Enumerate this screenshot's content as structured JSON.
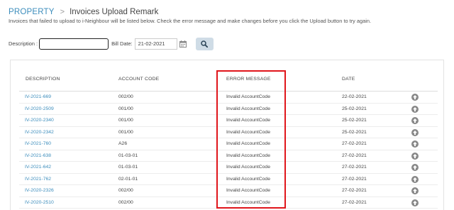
{
  "breadcrumb": {
    "root": "PROPERTY",
    "separator": ">",
    "current": "Invoices Upload Remark"
  },
  "subtitle": "Invoices that failed to upload to i-Neighbour will be listed below. Check the error message and make changes before you click the Upload button to try again.",
  "filters": {
    "description_label": "Description :",
    "description_value": "",
    "bill_date_label": "Bill Date:",
    "bill_date_value": "21-02-2021",
    "calendar_icon": "calendar-icon",
    "search_icon": "search-icon"
  },
  "table": {
    "headers": {
      "description": "DESCRIPTION",
      "account_code": "ACCOUNT CODE",
      "error_message": "ERROR MESSAGE",
      "date": "DATE"
    },
    "row_action_icon": "upload-arrow-icon",
    "rows": [
      {
        "description": "IV-2021-669",
        "account_code": "002/00",
        "error_message": "Invalid AccountCode",
        "date": "22-02-2021"
      },
      {
        "description": "IV-2020-2509",
        "account_code": "001/00",
        "error_message": "Invalid AccountCode",
        "date": "25-02-2021"
      },
      {
        "description": "IV-2020-2340",
        "account_code": "001/00",
        "error_message": "Invalid AccountCode",
        "date": "25-02-2021"
      },
      {
        "description": "IV-2020-2342",
        "account_code": "001/00",
        "error_message": "Invalid AccountCode",
        "date": "25-02-2021"
      },
      {
        "description": "IV-2021-760",
        "account_code": "A26",
        "error_message": "Invalid AccountCode",
        "date": "27-02-2021"
      },
      {
        "description": "IV-2021-638",
        "account_code": "01-03-01",
        "error_message": "Invalid AccountCode",
        "date": "27-02-2021"
      },
      {
        "description": "IV-2021-642",
        "account_code": "01-03-01",
        "error_message": "Invalid AccountCode",
        "date": "27-02-2021"
      },
      {
        "description": "IV-2021-762",
        "account_code": "02-01-01",
        "error_message": "Invalid AccountCode",
        "date": "27-02-2021"
      },
      {
        "description": "IV-2020-2326",
        "account_code": "002/00",
        "error_message": "Invalid AccountCode",
        "date": "27-02-2021"
      },
      {
        "description": "IV-2020-2510",
        "account_code": "002/00",
        "error_message": "Invalid AccountCode",
        "date": "27-02-2021"
      }
    ]
  },
  "colors": {
    "link": "#3c8dbc",
    "highlight_border": "#e0151b",
    "search_button": "#cfdce6"
  }
}
